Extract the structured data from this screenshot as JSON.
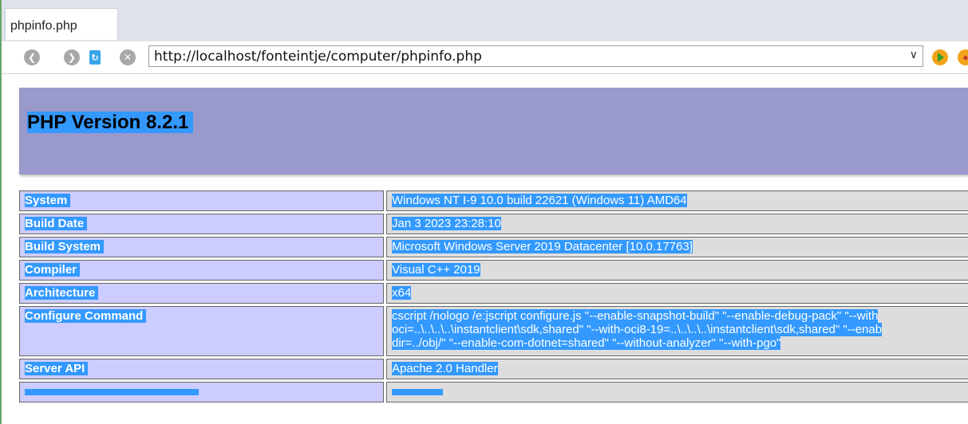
{
  "browser": {
    "tab_title": "phpinfo.php",
    "url": "http://localhost/fonteintje/computer/phpinfo.php",
    "icons": [
      "back-icon",
      "forward-icon",
      "refresh-icon",
      "stop-icon",
      "dropdown-icon",
      "go-icon",
      "addon-icon"
    ]
  },
  "page": {
    "heading": "PHP Version 8.2.1",
    "rows": [
      {
        "label": "System",
        "value": "Windows NT I-9 10.0 build 22621 (Windows 11) AMD64"
      },
      {
        "label": "Build Date",
        "value": "Jan 3 2023 23:28:10"
      },
      {
        "label": "Build System",
        "value": "Microsoft Windows Server 2019 Datacenter [10.0.17763]"
      },
      {
        "label": "Compiler",
        "value": "Visual C++ 2019"
      },
      {
        "label": "Architecture",
        "value": "x64"
      },
      {
        "label": "Configure Command",
        "value_lines": [
          "cscript /nologo /e:jscript configure.js \"--enable-snapshot-build\" \"--enable-debug-pack\" \"--with",
          "oci=..\\..\\..\\..\\instantclient\\sdk,shared\" \"--with-oci8-19=..\\..\\..\\..\\instantclient\\sdk,shared\" \"--enab",
          "dir=../obj/\" \"--enable-com-dotnet=shared\" \"--without-analyzer\" \"--with-pgo\""
        ]
      },
      {
        "label": "Server API",
        "value": "Apache 2.0 Handler"
      }
    ]
  },
  "colors": {
    "header_bg": "#9999cc",
    "label_bg": "#ccccff",
    "value_bg": "#dddddd",
    "selection": "#3399ff"
  }
}
